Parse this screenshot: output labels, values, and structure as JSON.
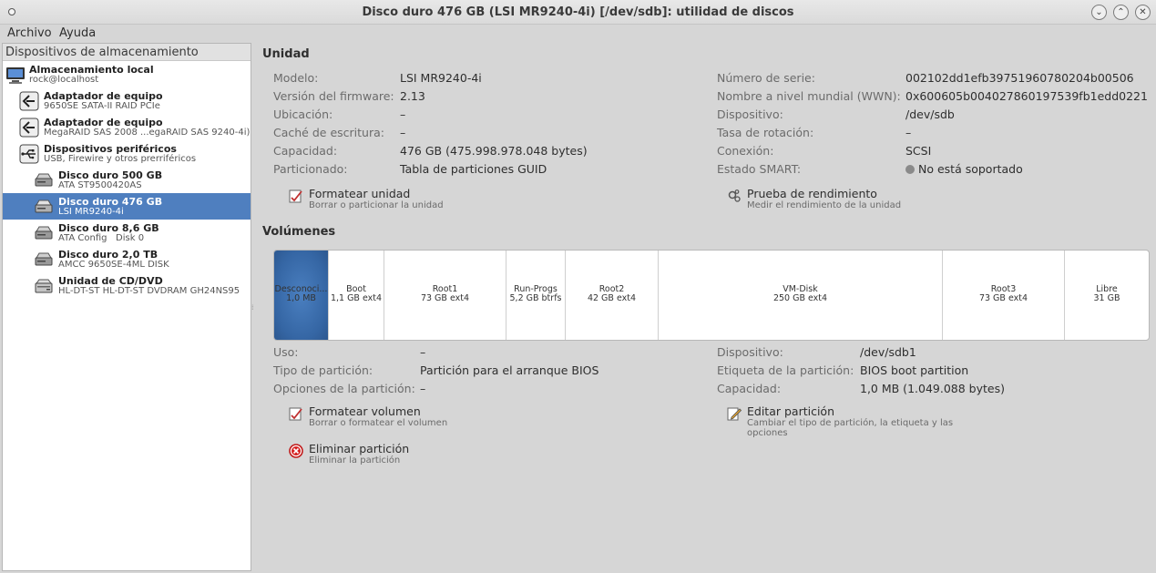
{
  "window": {
    "title": "Disco duro 476 GB (LSI MR9240-4i) [/dev/sdb]: utilidad de discos",
    "btn_minimize": "⌄",
    "btn_maximize": "⌃",
    "btn_close": "✕"
  },
  "menubar": {
    "archivo": "Archivo",
    "ayuda": "Ayuda"
  },
  "sidebar": {
    "header": "Dispositivos de almacenamiento",
    "items": [
      {
        "name": "Almacenamiento local",
        "sub": "rock@localhost",
        "icon": "computer-icon"
      },
      {
        "name": "Adaptador de equipo",
        "sub": "9650SE SATA-II RAID PCIe",
        "icon": "adapter-icon"
      },
      {
        "name": "Adaptador de equipo",
        "sub": "MegaRAID SAS 2008 ...egaRAID SAS 9240-4i)",
        "icon": "adapter-icon"
      },
      {
        "name": "Dispositivos periféricos",
        "sub": "USB, Firewire y otros prerriféricos",
        "icon": "usb-icon"
      },
      {
        "name": "Disco duro 500 GB",
        "sub": "ATA ST9500420AS",
        "icon": "harddisk-icon"
      },
      {
        "name": "Disco duro 476 GB",
        "sub": "LSI MR9240-4i",
        "icon": "harddisk-icon",
        "selected": true
      },
      {
        "name": "Disco duro 8,6 GB",
        "sub": "ATA Config   Disk 0",
        "icon": "harddisk-icon"
      },
      {
        "name": "Disco duro 2,0 TB",
        "sub": "AMCC 9650SE-4ML DISK",
        "icon": "harddisk-icon"
      },
      {
        "name": "Unidad de CD/DVD",
        "sub": "HL-DT-ST HL-DT-ST DVDRAM GH24NS95",
        "icon": "optical-drive-icon"
      }
    ]
  },
  "unidad": {
    "title": "Unidad",
    "left": [
      {
        "label": "Modelo:",
        "value": "LSI MR9240-4i"
      },
      {
        "label": "Versión del firmware:",
        "value": "2.13"
      },
      {
        "label": "Ubicación:",
        "value": "–"
      },
      {
        "label": "Caché de escritura:",
        "value": "–"
      },
      {
        "label": "Capacidad:",
        "value": "476 GB (475.998.978.048 bytes)"
      },
      {
        "label": "Particionado:",
        "value": "Tabla de particiones GUID"
      }
    ],
    "right": [
      {
        "label": "Número de serie:",
        "value": "002102dd1efb39751960780204b00506"
      },
      {
        "label": "Nombre a nivel mundial (WWN):",
        "value": "0x600605b004027860197539fb1edd0221"
      },
      {
        "label": "Dispositivo:",
        "value": "/dev/sdb"
      },
      {
        "label": "Tasa de rotación:",
        "value": "–"
      },
      {
        "label": "Conexión:",
        "value": "SCSI"
      },
      {
        "label": "Estado SMART:",
        "value": "No está soportado"
      }
    ],
    "actions": {
      "format": {
        "name": "Formatear unidad",
        "desc": "Borrar o particionar la unidad"
      },
      "benchmark": {
        "name": "Prueba de rendimiento",
        "desc": "Medir el rendimiento de la unidad"
      }
    }
  },
  "volumenes": {
    "title": "Volúmenes",
    "segments": [
      {
        "name": "Desconoci...",
        "info": "1,0 MB",
        "selected": true
      },
      {
        "name": "Boot",
        "info": "1,1 GB ext4"
      },
      {
        "name": "Root1",
        "info": "73 GB ext4"
      },
      {
        "name": "Run-Progs",
        "info": "5,2 GB btrfs"
      },
      {
        "name": "Root2",
        "info": "42 GB ext4"
      },
      {
        "name": "VM-Disk",
        "info": "250 GB ext4"
      },
      {
        "name": "Root3",
        "info": "73 GB ext4"
      },
      {
        "name": "Libre",
        "info": "31 GB"
      }
    ],
    "left": [
      {
        "label": "Uso:",
        "value": "–"
      },
      {
        "label": "Tipo de partición:",
        "value": "Partición para el arranque BIOS"
      },
      {
        "label": "Opciones de la partición:",
        "value": "–"
      }
    ],
    "right": [
      {
        "label": "Dispositivo:",
        "value": "/dev/sdb1"
      },
      {
        "label": "Etiqueta de la partición:",
        "value": "BIOS boot partition"
      },
      {
        "label": "Capacidad:",
        "value": "1,0 MB (1.049.088 bytes)"
      }
    ],
    "actions": {
      "format": {
        "name": "Formatear volumen",
        "desc": "Borrar o formatear el volumen"
      },
      "edit": {
        "name": "Editar partición",
        "desc1": "Cambiar el tipo de partición, la etiqueta y las",
        "desc2": "opciones"
      },
      "delete": {
        "name": "Eliminar partición",
        "desc": "Eliminar la partición"
      }
    }
  },
  "colors": {
    "selection": "#4f7fbf",
    "selected_segment": "#3566a4",
    "window_bg": "#d6d6d6"
  }
}
